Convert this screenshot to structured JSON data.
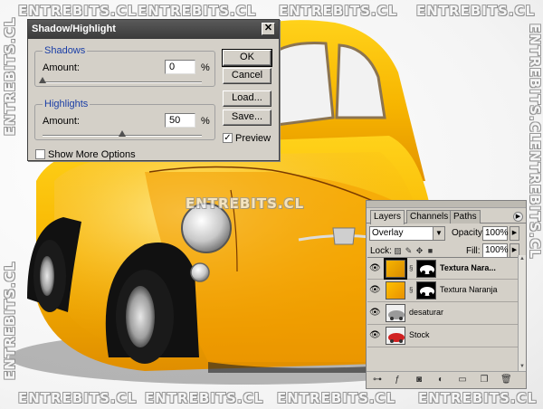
{
  "watermark": "ENTREBITS.CL",
  "dialog": {
    "title": "Shadow/Highlight",
    "close_glyph": "✕",
    "shadows": {
      "title": "Shadows",
      "amount_label": "Amount:",
      "amount_value": "0",
      "unit": "%",
      "slider_level": 0
    },
    "highlights": {
      "title": "Highlights",
      "amount_label": "Amount:",
      "amount_value": "50",
      "unit": "%",
      "slider_level": 50
    },
    "show_more_label": "Show More Options",
    "show_more_checked": false,
    "buttons": {
      "ok": "OK",
      "cancel": "Cancel",
      "load": "Load...",
      "save": "Save..."
    },
    "preview_label": "Preview",
    "preview_checked": true
  },
  "layers_panel": {
    "tabs": [
      "Layers",
      "Channels",
      "Paths"
    ],
    "blend_mode": "Overlay",
    "opacity_label": "Opacity:",
    "opacity_value": "100%",
    "lock_label": "Lock:",
    "fill_label": "Fill:",
    "fill_value": "100%",
    "layers": [
      {
        "name": "Textura Nara...",
        "selected": true,
        "visible": true,
        "thumb": "orange-texture",
        "has_mask": true
      },
      {
        "name": "Textura Naranja",
        "selected": false,
        "visible": true,
        "thumb": "orange-texture",
        "has_mask": true
      },
      {
        "name": "desaturar",
        "selected": false,
        "visible": true,
        "thumb": "gray-car",
        "has_mask": false
      },
      {
        "name": "Stock",
        "selected": false,
        "visible": true,
        "thumb": "red-car",
        "has_mask": false
      }
    ],
    "bottom_icons": [
      "link-icon",
      "layer-style-icon",
      "mask-icon",
      "adjustment-icon",
      "group-icon",
      "new-layer-icon",
      "trash-icon"
    ]
  },
  "colors": {
    "car_yellow": "#f7b500",
    "car_orange": "#f29a00",
    "dialog_bg": "#d4d0c8",
    "titlebar": "#3a3a3a",
    "group_title": "#1a3ea6"
  }
}
